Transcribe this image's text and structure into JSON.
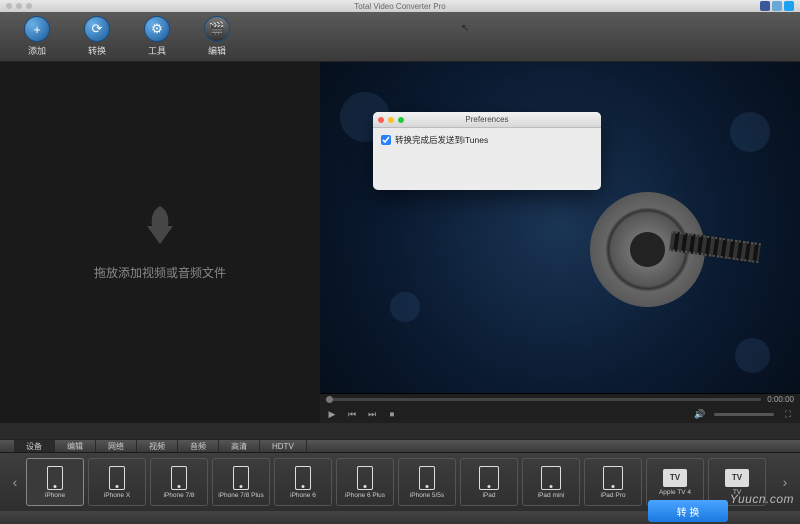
{
  "app": {
    "title": "Total Video Converter Pro"
  },
  "toolbar": [
    {
      "label": "添加",
      "glyph": "+"
    },
    {
      "label": "转换",
      "glyph": "⟳"
    },
    {
      "label": "工具",
      "glyph": "⚙"
    },
    {
      "label": "编辑",
      "glyph": "✎"
    }
  ],
  "dropzone": {
    "text": "拖放添加视频或音频文件"
  },
  "player": {
    "time": "0:00:00"
  },
  "preferences": {
    "title": "Preferences",
    "option_label": "转换完成后发送到iTunes",
    "option_checked": true
  },
  "tabs": [
    "设备",
    "编辑",
    "网络",
    "视频",
    "音频",
    "高清",
    "HDTV"
  ],
  "active_tab": 0,
  "devices": [
    {
      "label": "iPhone",
      "type": "phone"
    },
    {
      "label": "iPhone X",
      "type": "phone"
    },
    {
      "label": "iPhone 7/8",
      "type": "phone"
    },
    {
      "label": "iPhone 7/8 Plus",
      "type": "phone"
    },
    {
      "label": "iPhone 6",
      "type": "phone"
    },
    {
      "label": "iPhone 6 Plus",
      "type": "phone"
    },
    {
      "label": "iPhone 5/5s",
      "type": "phone"
    },
    {
      "label": "iPad",
      "type": "tablet"
    },
    {
      "label": "iPad mini",
      "type": "tablet"
    },
    {
      "label": "iPad Pro",
      "type": "tablet"
    },
    {
      "label": "Apple TV 4",
      "type": "tv"
    },
    {
      "label": "TV",
      "type": "tv"
    }
  ],
  "selected_device": 0,
  "convert_button": "转 换",
  "watermark": "Yuucn.com",
  "social": {
    "facebook": "#3b5998",
    "instagram": "#c13584",
    "twitter": "#1da1f2"
  }
}
